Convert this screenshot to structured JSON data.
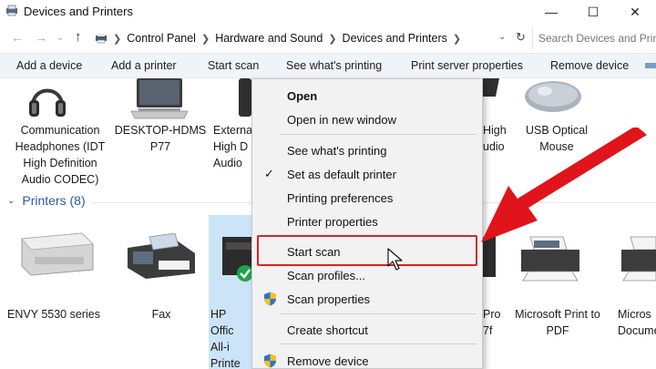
{
  "window": {
    "title": "Devices and Printers"
  },
  "address": {
    "crumbs": [
      "Control Panel",
      "Hardware and Sound",
      "Devices and Printers"
    ],
    "search_placeholder": "Search Devices and Printers"
  },
  "toolbar": {
    "items": [
      "Add a device",
      "Add a printer",
      "Start scan",
      "See what's printing",
      "Print server properties",
      "Remove device"
    ]
  },
  "devices": {
    "row1": [
      {
        "label": "Communication\nHeadphones (IDT\nHigh Definition\nAudio CODEC)",
        "icon": "headphones-icon"
      },
      {
        "label": "DESKTOP-HDMS\nP77",
        "icon": "laptop-icon"
      },
      {
        "label": "Externa\nHigh D\nAudio",
        "icon": "speaker-icon"
      },
      {
        "label": "High\nudio",
        "icon": "speaker-icon"
      },
      {
        "label": "USB Optical\nMouse",
        "icon": "mouse-icon"
      }
    ],
    "printers_header": "Printers (8)",
    "row2": [
      {
        "label": "ENVY 5530 series",
        "icon": "printer-icon"
      },
      {
        "label": "Fax",
        "icon": "fax-icon"
      },
      {
        "label": "HP Offic\nAll-i\nPrinte",
        "icon": "printer-icon"
      },
      {
        "label": "Pro\n7f",
        "icon": "printer-icon"
      },
      {
        "label": "Microsoft Print to\nPDF",
        "icon": "printer-icon"
      },
      {
        "label": "Micros\nDocume",
        "icon": "printer-icon"
      }
    ]
  },
  "context_menu": {
    "open": "Open",
    "open_new_window": "Open in new window",
    "see_printing": "See what's printing",
    "set_default": "Set as default printer",
    "printing_prefs": "Printing preferences",
    "printer_props": "Printer properties",
    "start_scan": "Start scan",
    "scan_profiles": "Scan profiles...",
    "scan_props": "Scan properties",
    "create_shortcut": "Create shortcut",
    "remove_device": "Remove device"
  },
  "colors": {
    "accent": "#2b5b9e",
    "highlight_border": "#d6242b",
    "arrow": "#e0141a",
    "selection": "#cce4f7"
  }
}
